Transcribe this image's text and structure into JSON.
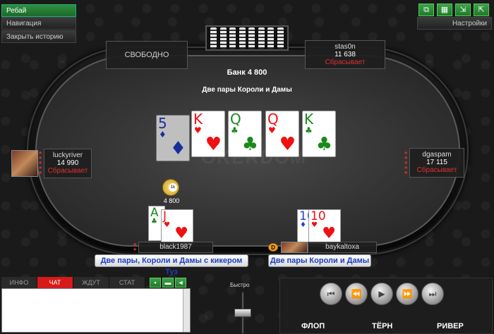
{
  "menu": {
    "rebuy": "Ребай",
    "navigation": "Навигация",
    "close_history": "Закрыть историю"
  },
  "toolbar": {
    "settings": "Настройки"
  },
  "table": {
    "pot": "Банк 4 800",
    "board_desc": "Две пары Короли и Дамы",
    "watermark": "OKERDOM",
    "free_seat": "СВОБОДНО"
  },
  "players": [
    {
      "name": "stas0n",
      "stack": "11 638",
      "status": "Сбрасывает"
    },
    {
      "name": "luckyriver",
      "stack": "14 990",
      "status": "Сбрасывает"
    },
    {
      "name": "dgaspam",
      "stack": "17 115",
      "status": "Сбрасывает"
    },
    {
      "name": "black1987",
      "stack": "",
      "status": ""
    },
    {
      "name": "baykaltoxa",
      "stack": "",
      "status": ""
    }
  ],
  "board": [
    {
      "rank": "5",
      "suit": "♦",
      "color": "blue",
      "dim": true
    },
    {
      "rank": "K",
      "suit": "♥",
      "color": "red"
    },
    {
      "rank": "Q",
      "suit": "♣",
      "color": "green"
    },
    {
      "rank": "Q",
      "suit": "♥",
      "color": "red"
    },
    {
      "rank": "K",
      "suit": "♣",
      "color": "green"
    }
  ],
  "hands": {
    "black1987": {
      "cards": [
        {
          "rank": "A",
          "suit": "♣",
          "color": "green"
        },
        {
          "rank": "J",
          "suit": "♥",
          "color": "red"
        }
      ],
      "label": "Две пары, Короли и Дамы с кикером Туз"
    },
    "baykaltoxa": {
      "cards": [
        {
          "rank": "10",
          "suit": "♦",
          "color": "blue"
        },
        {
          "rank": "10",
          "suit": "♥",
          "color": "red"
        }
      ],
      "label": "Две пары Короли и Дамы"
    }
  },
  "chips": {
    "badge": "1k",
    "amount": "4 800"
  },
  "dealer": "D",
  "chat": {
    "tabs": [
      "ИНФО",
      "ЧАТ",
      "ЖДУТ",
      "СТАТ"
    ],
    "active_tab": 1
  },
  "player": {
    "speed_label": "Быстро"
  },
  "streets": [
    "ФЛОП",
    "ТЁРН",
    "РИВЕР"
  ],
  "icons": [
    "to-start-icon",
    "rewind-icon",
    "play-icon",
    "fast-forward-icon",
    "to-end-icon"
  ]
}
